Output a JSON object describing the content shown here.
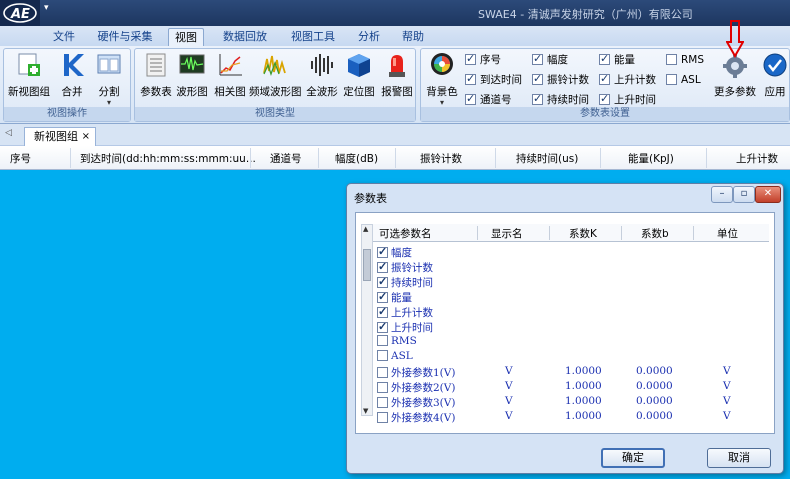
{
  "window": {
    "title": "SWAE4 - 清诚声发射研究（广州）有限公司"
  },
  "menu": {
    "tabs": [
      "文件",
      "硬件与采集",
      "视图",
      "数据回放",
      "视图工具",
      "分析",
      "帮助"
    ]
  },
  "ribbon": {
    "view_ops": {
      "title": "视图操作",
      "new_group": "新视图组",
      "merge": "合并",
      "split": "分割"
    },
    "view_types": {
      "title": "视图类型",
      "params": "参数表",
      "waveform": "波形图",
      "correlation": "相关图",
      "freq_waveform": "频域波形图",
      "full_waveform": "全波形",
      "location": "定位图",
      "alarm": "报警图"
    },
    "param_settings": {
      "title": "参数表设置",
      "background_color": "背景色",
      "more_params": "更多参数",
      "apply": "应用",
      "options": [
        {
          "label": "序号",
          "checked": true
        },
        {
          "label": "到达时间",
          "checked": true
        },
        {
          "label": "通道号",
          "checked": true
        },
        {
          "label": "幅度",
          "checked": true
        },
        {
          "label": "振铃计数",
          "checked": true
        },
        {
          "label": "持续时间",
          "checked": true
        },
        {
          "label": "能量",
          "checked": true
        },
        {
          "label": "上升计数",
          "checked": true
        },
        {
          "label": "上升时间",
          "checked": true
        },
        {
          "label": "RMS",
          "checked": false
        },
        {
          "label": "ASL",
          "checked": false
        }
      ]
    }
  },
  "doc_tab": {
    "label": "新视图组",
    "close": "×"
  },
  "columns": [
    "序号",
    "到达时间(dd:hh:mm:ss:mmm:uu...",
    "通道号",
    "幅度(dB)",
    "振铃计数",
    "持续时间(us)",
    "能量(KpJ)",
    "上升计数"
  ],
  "dialog": {
    "title": "参数表",
    "headers": [
      "可选参数名",
      "显示名",
      "系数K",
      "系数b",
      "单位"
    ],
    "rows": [
      {
        "name": "幅度",
        "checked": true,
        "display": "",
        "k": "",
        "b": "",
        "unit": ""
      },
      {
        "name": "振铃计数",
        "checked": true,
        "display": "",
        "k": "",
        "b": "",
        "unit": ""
      },
      {
        "name": "持续时间",
        "checked": true,
        "display": "",
        "k": "",
        "b": "",
        "unit": ""
      },
      {
        "name": "能量",
        "checked": true,
        "display": "",
        "k": "",
        "b": "",
        "unit": ""
      },
      {
        "name": "上升计数",
        "checked": true,
        "display": "",
        "k": "",
        "b": "",
        "unit": ""
      },
      {
        "name": "上升时间",
        "checked": true,
        "display": "",
        "k": "",
        "b": "",
        "unit": ""
      },
      {
        "name": "RMS",
        "checked": false,
        "display": "",
        "k": "",
        "b": "",
        "unit": ""
      },
      {
        "name": "ASL",
        "checked": false,
        "display": "",
        "k": "",
        "b": "",
        "unit": ""
      },
      {
        "name": "外接参数1(V)",
        "checked": false,
        "display": "V",
        "k": "1.0000",
        "b": "0.0000",
        "unit": "V"
      },
      {
        "name": "外接参数2(V)",
        "checked": false,
        "display": "V",
        "k": "1.0000",
        "b": "0.0000",
        "unit": "V"
      },
      {
        "name": "外接参数3(V)",
        "checked": false,
        "display": "V",
        "k": "1.0000",
        "b": "0.0000",
        "unit": "V"
      },
      {
        "name": "外接参数4(V)",
        "checked": false,
        "display": "V",
        "k": "1.0000",
        "b": "0.0000",
        "unit": "V"
      }
    ],
    "ok": "确定",
    "cancel": "取消"
  },
  "colors": {
    "data_background": "#00adef",
    "arrow": "#e00000"
  }
}
